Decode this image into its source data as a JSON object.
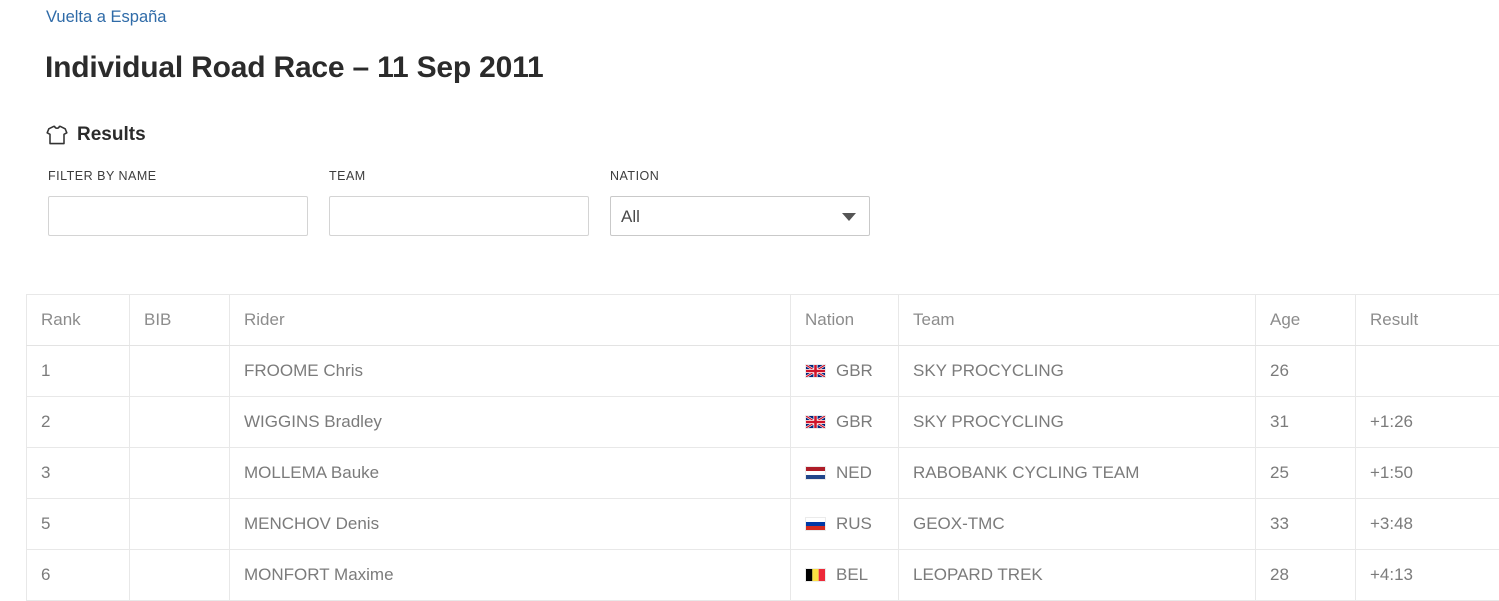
{
  "breadcrumb": {
    "label": "Vuelta a España",
    "color": "#2f6ba8"
  },
  "page_title": "Individual Road Race – 11 Sep 2011",
  "results_section": {
    "icon": "jersey-icon",
    "heading": "Results"
  },
  "filters": {
    "name": {
      "label": "FILTER BY NAME",
      "value": "",
      "placeholder": ""
    },
    "team": {
      "label": "TEAM",
      "value": "",
      "placeholder": ""
    },
    "nation": {
      "label": "NATION",
      "selected": "All",
      "options": [
        "All"
      ]
    }
  },
  "table": {
    "columns": [
      "Rank",
      "BIB",
      "Rider",
      "Nation",
      "Team",
      "Age",
      "Result"
    ],
    "rows": [
      {
        "rank": "1",
        "bib": "",
        "rider": "FROOME Chris",
        "nation_code": "GBR",
        "flag": "flag-gbr",
        "team": "SKY PROCYCLING",
        "age": "26",
        "result": ""
      },
      {
        "rank": "2",
        "bib": "",
        "rider": "WIGGINS Bradley",
        "nation_code": "GBR",
        "flag": "flag-gbr",
        "team": "SKY PROCYCLING",
        "age": "31",
        "result": "+1:26"
      },
      {
        "rank": "3",
        "bib": "",
        "rider": "MOLLEMA Bauke",
        "nation_code": "NED",
        "flag": "flag-ned",
        "team": "RABOBANK CYCLING TEAM",
        "age": "25",
        "result": "+1:50"
      },
      {
        "rank": "5",
        "bib": "",
        "rider": "MENCHOV Denis",
        "nation_code": "RUS",
        "flag": "flag-rus",
        "team": "GEOX-TMC",
        "age": "33",
        "result": "+3:48"
      },
      {
        "rank": "6",
        "bib": "",
        "rider": "MONFORT Maxime",
        "nation_code": "BEL",
        "flag": "flag-bel",
        "team": "LEOPARD TREK",
        "age": "28",
        "result": "+4:13"
      }
    ]
  }
}
